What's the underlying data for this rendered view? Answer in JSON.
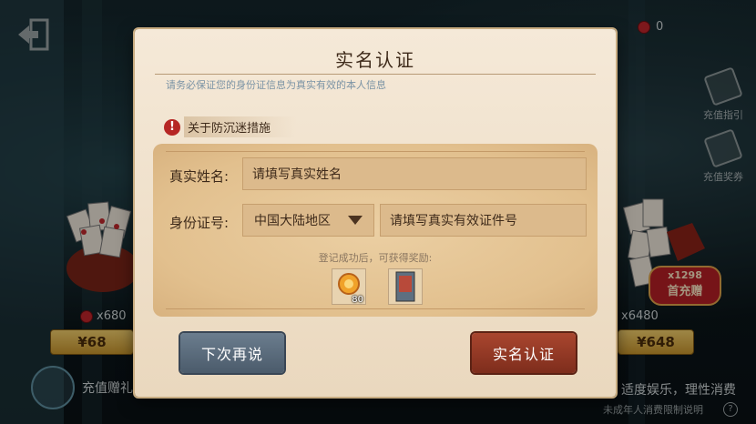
{
  "dialog": {
    "title": "实名认证",
    "subtitle": "请务必保证您的身份证信息为真实有效的本人信息",
    "notice": "关于防沉迷措施",
    "name_label": "真实姓名:",
    "name_placeholder": "请填写真实姓名",
    "id_label": "身份证号:",
    "region_selected": "中国大陆地区",
    "id_placeholder": "请填写真实有效证件号",
    "reward_hint": "登记成功后，可获得奖励:",
    "reward_count": "80",
    "later_button": "下次再说",
    "verify_button": "实名认证"
  },
  "background": {
    "currency_value": "0",
    "side_guide": "充值指引",
    "side_coupon": "充值奖券",
    "left_pack_amount": "x680",
    "left_pack_price": "¥68",
    "right_pack_amount": "x6480",
    "right_pack_price": "¥648",
    "right_badge_amount": "x1298",
    "right_badge_text": "首充赠",
    "left_footer": "充值赠礼",
    "right_footer_main": "适度娱乐，理性消费",
    "right_footer_sub": "未成年人消费限制说明",
    "accent_red": "#b61f26",
    "gold": "#e0a34a"
  }
}
